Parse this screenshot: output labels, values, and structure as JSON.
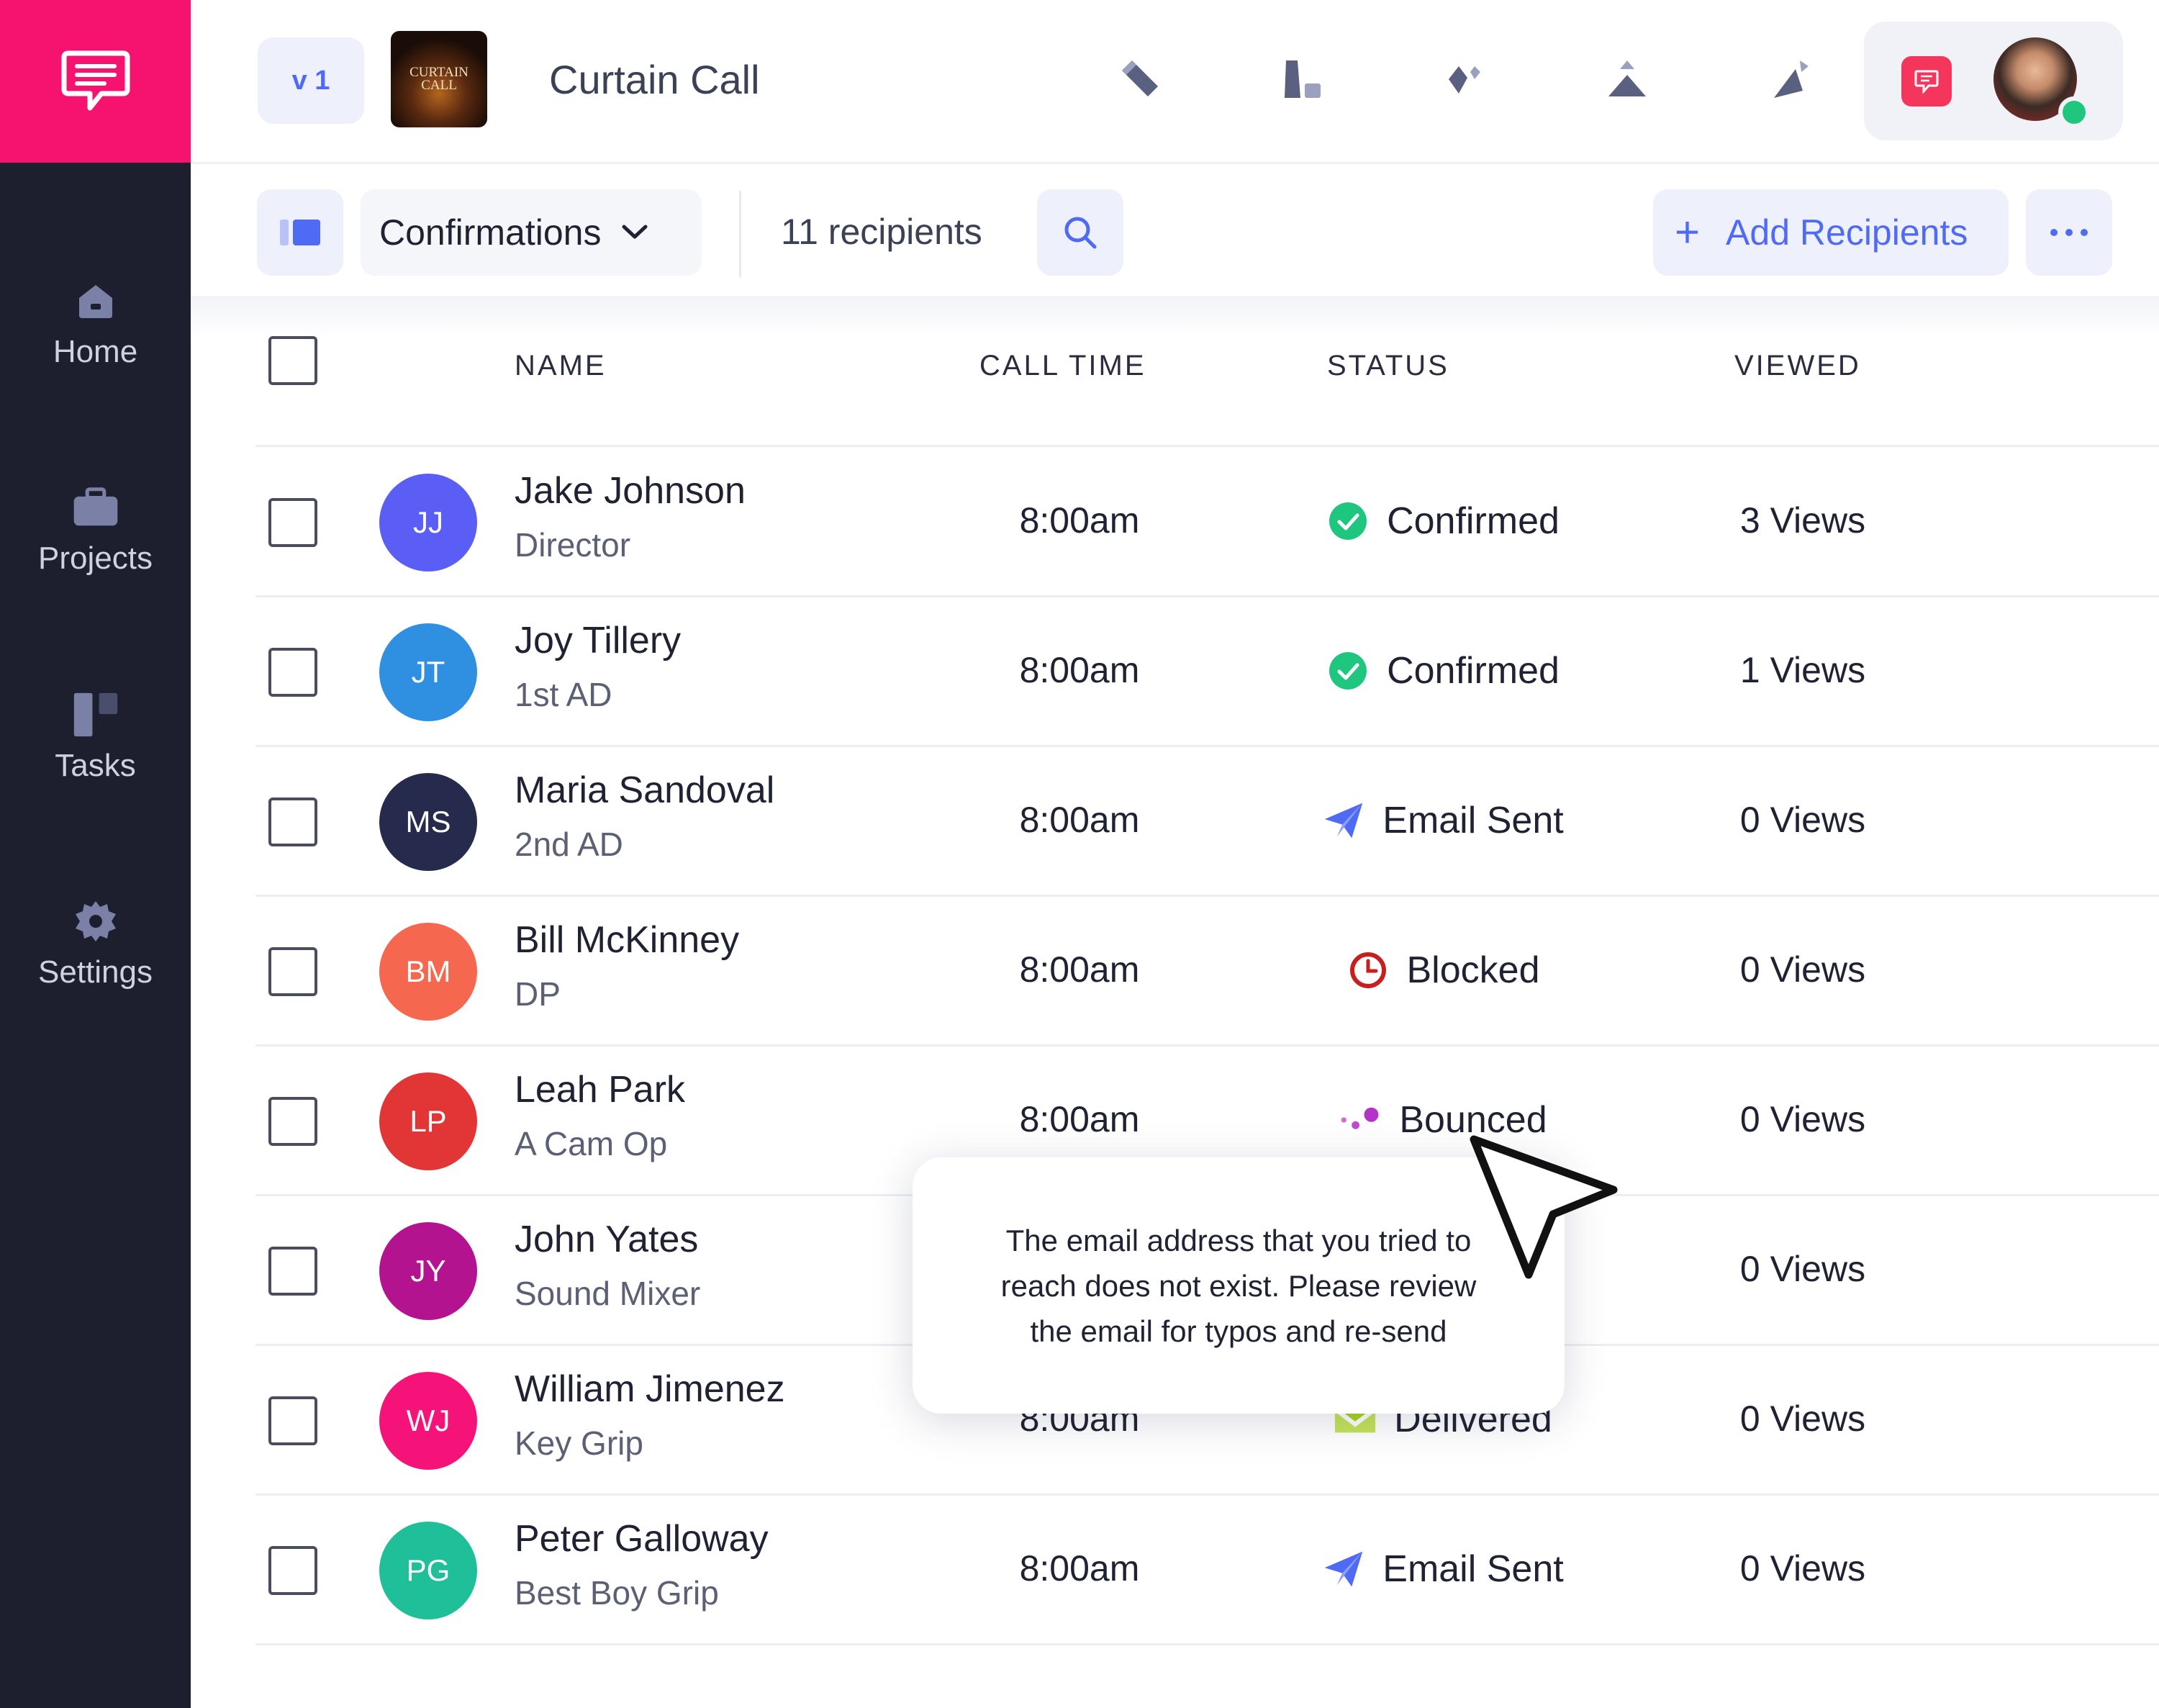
{
  "app": {
    "version_label": "v 1",
    "project_title": "Curtain Call",
    "poster_text": [
      "CURTAIN",
      "CALL"
    ]
  },
  "colors": {
    "brand": "#f5136f",
    "sidebar": "#1e1f2e",
    "accent": "#4f6bf5",
    "confirmed": "#1fc77e",
    "blocked": "#c81e1e",
    "bounced": "#b432c8",
    "delivered": "#a8d41e"
  },
  "sidebar": {
    "items": [
      {
        "label": "Home",
        "icon": "home-icon"
      },
      {
        "label": "Projects",
        "icon": "briefcase-icon"
      },
      {
        "label": "Tasks",
        "icon": "tasks-icon"
      },
      {
        "label": "Settings",
        "icon": "gear-icon"
      }
    ]
  },
  "toolbar": {
    "view_name": "Confirmations",
    "recipients_count": "11 recipients",
    "add_label": "Add Recipients",
    "add_symbol": "+"
  },
  "table": {
    "columns": [
      "NAME",
      "CALL TIME",
      "STATUS",
      "VIEWED"
    ],
    "rows": [
      {
        "initials": "JJ",
        "name": "Jake Johnson",
        "role": "Director",
        "call_time": "8:00am",
        "status": "Confirmed",
        "status_icon": "check-circle-icon",
        "views": "3 Views",
        "avatar_color": "#5b5ef5"
      },
      {
        "initials": "JT",
        "name": "Joy Tillery",
        "role": "1st AD",
        "call_time": "8:00am",
        "status": "Confirmed",
        "status_icon": "check-circle-icon",
        "views": "1 Views",
        "avatar_color": "#2f8fe0"
      },
      {
        "initials": "MS",
        "name": "Maria Sandoval",
        "role": "2nd AD",
        "call_time": "8:00am",
        "status": "Email Sent",
        "status_icon": "paper-plane-icon",
        "views": "0 Views",
        "avatar_color": "#262b4e"
      },
      {
        "initials": "BM",
        "name": "Bill McKinney",
        "role": "DP",
        "call_time": "8:00am",
        "status": "Blocked",
        "status_icon": "clock-blocked-icon",
        "views": "0 Views",
        "avatar_color": "#f5674e"
      },
      {
        "initials": "LP",
        "name": "Leah Park",
        "role": "A Cam Op",
        "call_time": "8:00am",
        "status": "Bounced",
        "status_icon": "bounce-dots-icon",
        "views": "0 Views",
        "avatar_color": "#e23535"
      },
      {
        "initials": "JY",
        "name": "John Yates",
        "role": "Sound Mixer",
        "call_time": "",
        "status": "",
        "status_icon": "",
        "views": "0 Views",
        "avatar_color": "#b3138f"
      },
      {
        "initials": "WJ",
        "name": "William Jimenez",
        "role": "Key Grip",
        "call_time": "8:00am",
        "status": "Delivered",
        "status_icon": "envelope-icon",
        "views": "0 Views",
        "avatar_color": "#f5137a"
      },
      {
        "initials": "PG",
        "name": "Peter Galloway",
        "role": "Best Boy Grip",
        "call_time": "8:00am",
        "status": "Email Sent",
        "status_icon": "paper-plane-icon",
        "views": "0 Views",
        "avatar_color": "#1fbf99"
      }
    ]
  },
  "tooltip": {
    "lines": [
      "The email address that you tried to",
      "reach does not exist. Please review",
      "the email for typos and re-send"
    ]
  }
}
